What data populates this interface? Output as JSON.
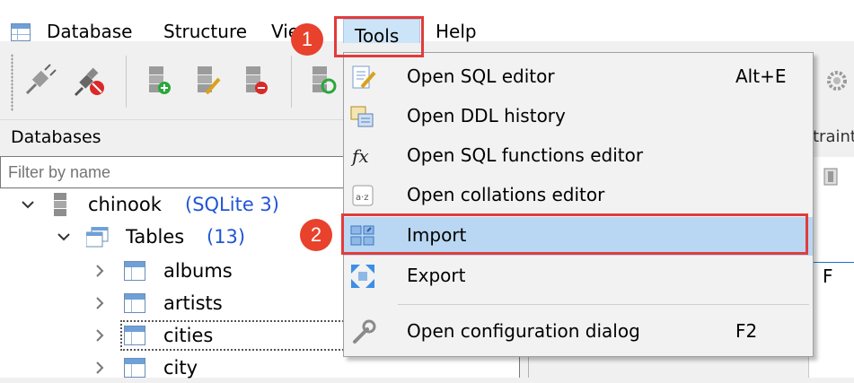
{
  "menubar": {
    "items": [
      "Database",
      "Structure",
      "View",
      "Tools",
      "Help"
    ]
  },
  "callouts": {
    "first": "1",
    "second": "2"
  },
  "databases_panel": {
    "title": "Databases",
    "filter_placeholder": "Filter by name",
    "tree": {
      "db_name": "chinook",
      "db_type": "(SQLite 3)",
      "tables_label": "Tables",
      "tables_count": "(13)",
      "tables": [
        "albums",
        "artists",
        "cities",
        "city"
      ]
    }
  },
  "right_panel": {
    "tab_fragment": "traint",
    "col_fragment": "F"
  },
  "tools_menu": {
    "items": [
      {
        "label": "Open SQL editor",
        "shortcut": "Alt+E",
        "icon": "sql-editor-icon"
      },
      {
        "label": "Open DDL history",
        "shortcut": "",
        "icon": "ddl-history-icon"
      },
      {
        "label": "Open SQL functions editor",
        "shortcut": "",
        "icon": "fx-icon"
      },
      {
        "label": "Open collations editor",
        "shortcut": "",
        "icon": "collation-icon"
      },
      {
        "label": "Import",
        "shortcut": "",
        "icon": "import-icon"
      },
      {
        "label": "Export",
        "shortcut": "",
        "icon": "export-icon"
      },
      {
        "label": "Open configuration dialog",
        "shortcut": "F2",
        "icon": "wrench-icon"
      }
    ]
  },
  "colors": {
    "highlight_red": "#e23b3b",
    "selected_blue": "#b9d7f2",
    "badge_red": "#e8412c",
    "link_blue": "#1f55d6"
  }
}
